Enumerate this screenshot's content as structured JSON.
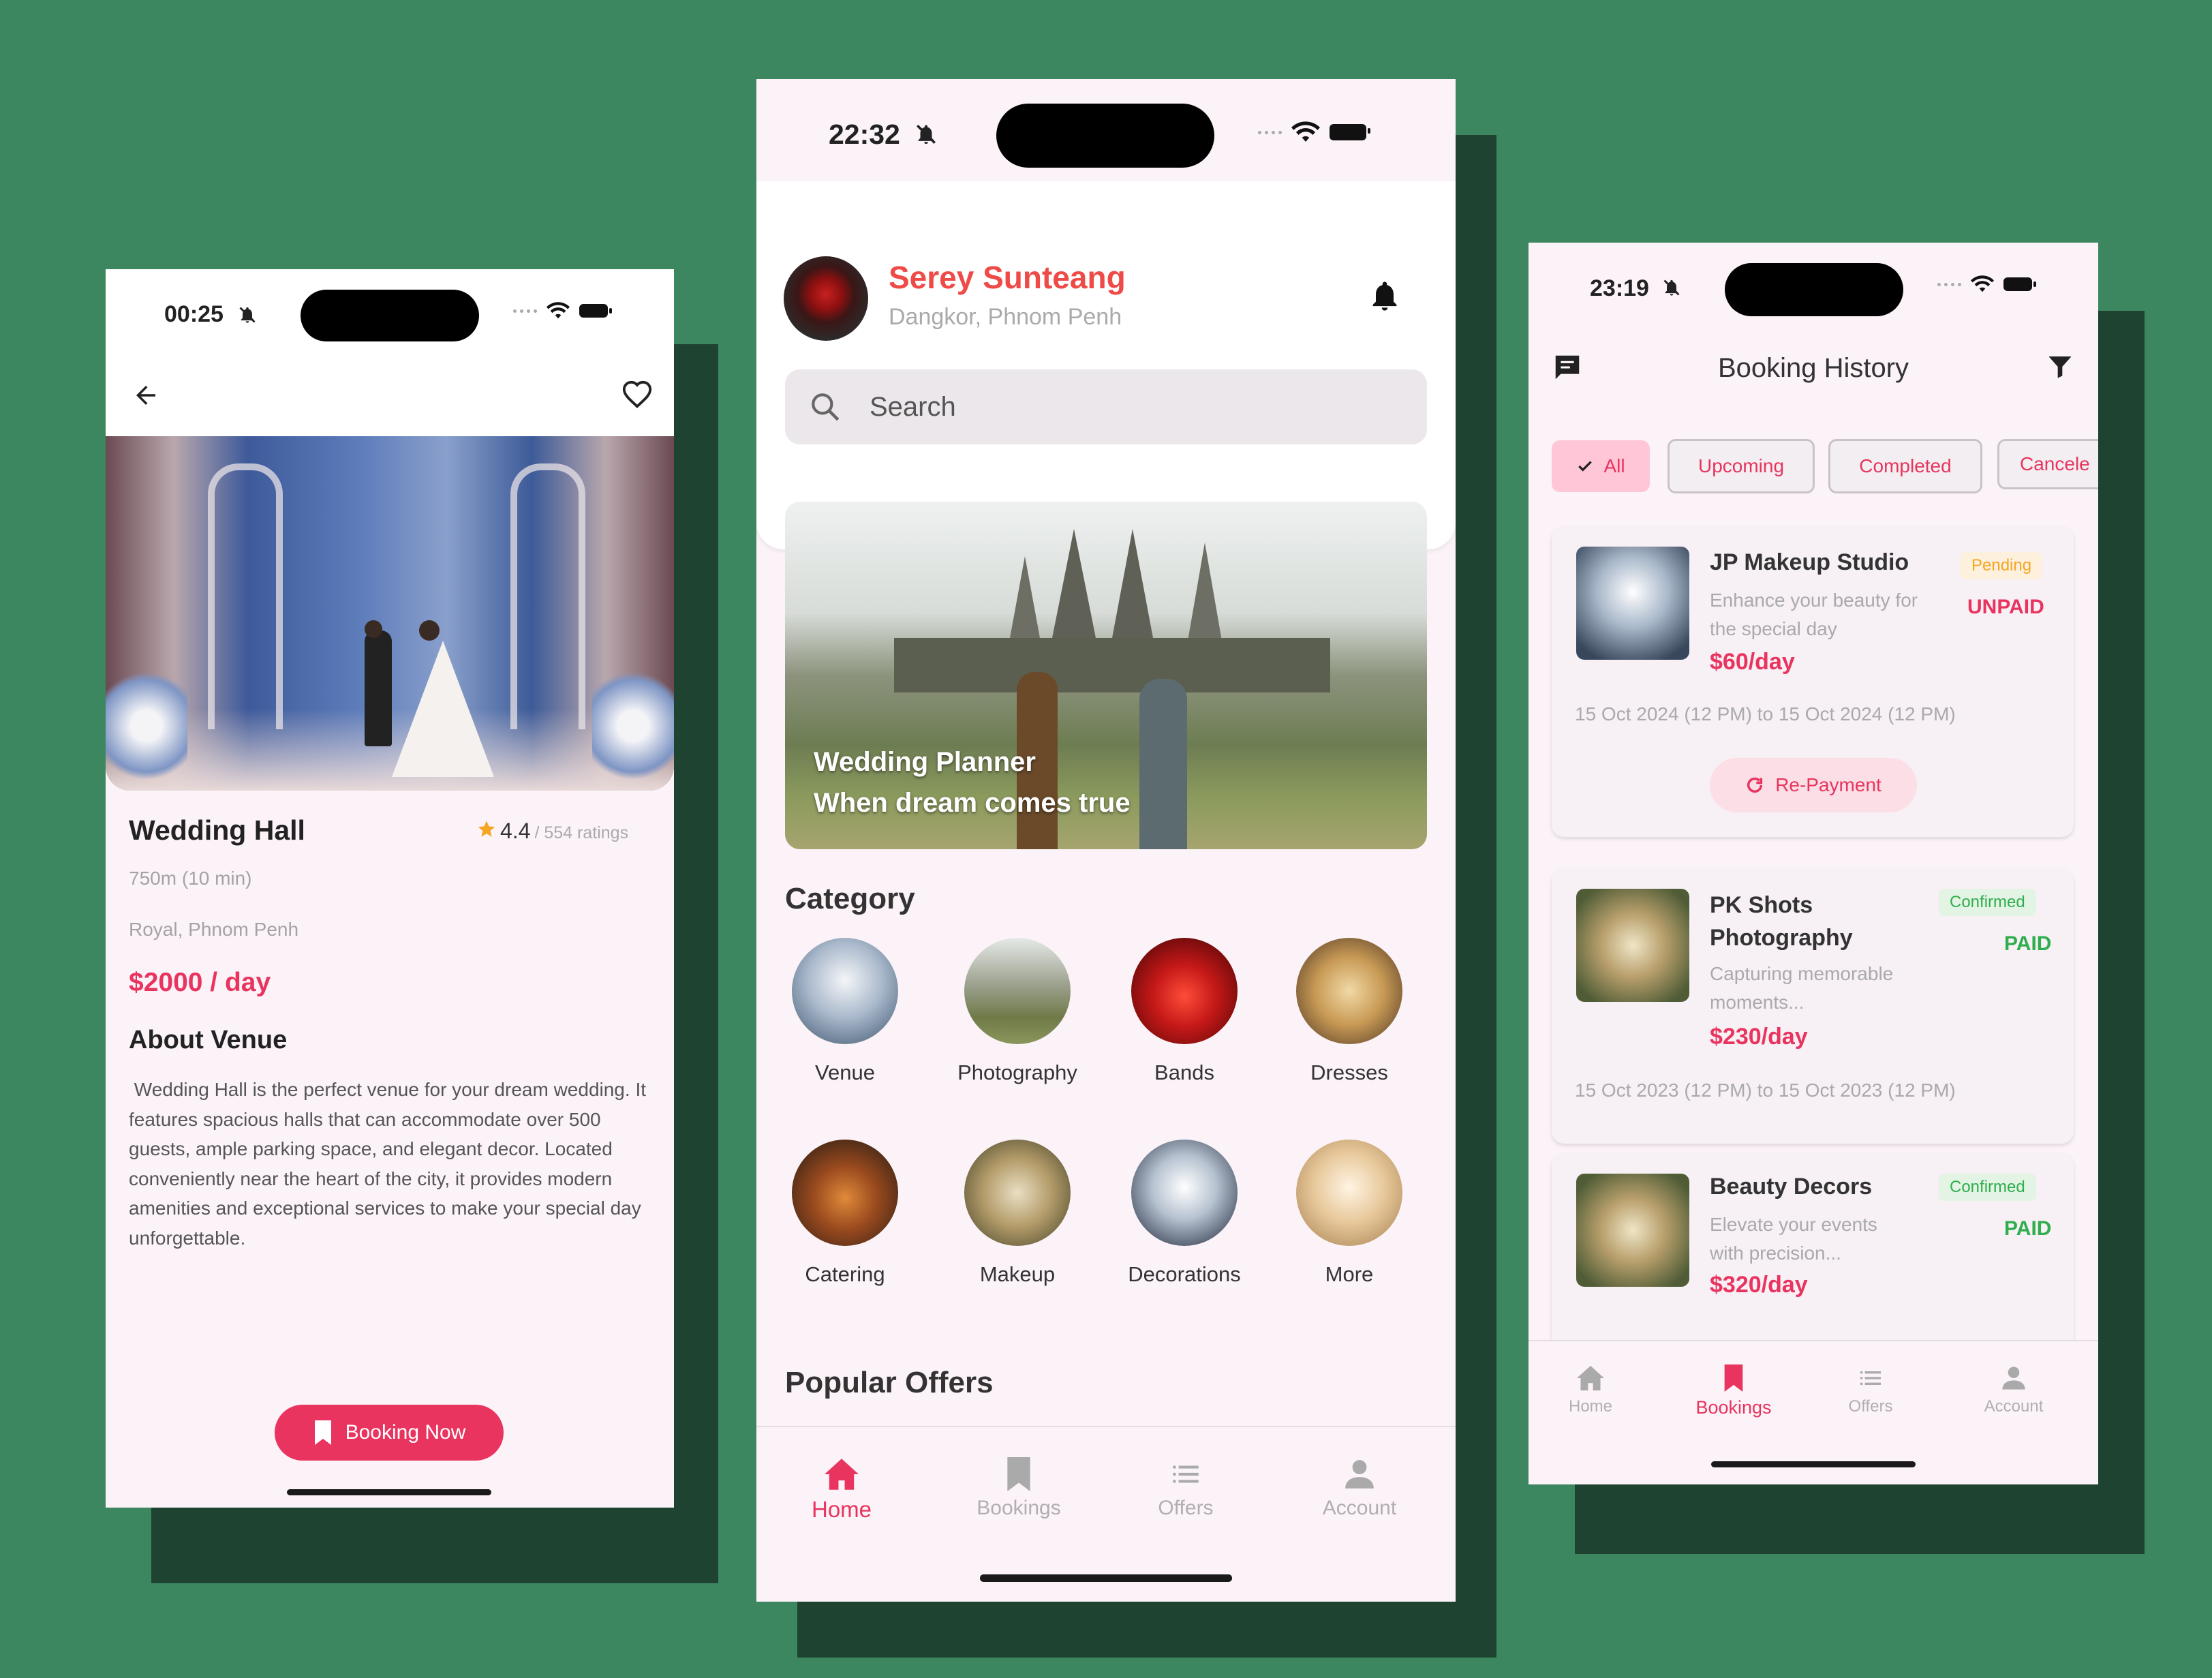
{
  "left": {
    "status_time": "00:25",
    "hero_image": "wedding-hall-stage-photo",
    "title": "Wedding Hall",
    "rating": "4.4",
    "rating_count": "/ 554 ratings",
    "distance": "750m (10 min)",
    "location": "Royal, Phnom Penh",
    "price": "$2000 / day",
    "about_heading": "About Venue",
    "about_text": " Wedding Hall is the perfect venue for your dream wedding. It features spacious halls that can accommodate over 500 guests, ample parking space, and elegant decor. Located conveniently near the heart of the city, it provides modern amenities and exceptional services to make your special day unforgettable.",
    "booking_button": "Booking Now"
  },
  "center": {
    "status_time": "22:32",
    "user_name": "Serey Sunteang",
    "user_location": "Dangkor, Phnom Penh",
    "search_placeholder": "Search",
    "banner_line1": "Wedding Planner",
    "banner_line2": "When dream comes true",
    "category_heading": "Category",
    "categories": [
      "Venue",
      "Photography",
      "Bands",
      "Dresses",
      "Catering",
      "Makeup",
      "Decorations",
      "More"
    ],
    "popular_heading": "Popular Offers",
    "nav": [
      "Home",
      "Bookings",
      "Offers",
      "Account"
    ]
  },
  "right": {
    "status_time": "23:19",
    "title": "Booking History",
    "filters": [
      "All",
      "Upcoming",
      "Completed",
      "Cancele"
    ],
    "bookings": [
      {
        "name": "JP Makeup Studio",
        "desc1": "Enhance your beauty for",
        "desc2": "the special day",
        "price": "$60/day",
        "status": "Pending",
        "payment": "UNPAID",
        "dates": "15 Oct 2024 (12 PM) to 15 Oct 2024 (12 PM)",
        "action": "Re-Payment"
      },
      {
        "name1": "PK Shots",
        "name2": "Photography",
        "desc1": "Capturing memorable",
        "desc2": "moments...",
        "price": "$230/day",
        "status": "Confirmed",
        "payment": "PAID",
        "dates": "15 Oct 2023 (12 PM) to 15 Oct 2023 (12 PM)"
      },
      {
        "name": "Beauty Decors",
        "desc1": "Elevate your events",
        "desc2": "with precision...",
        "price": "$320/day",
        "status": "Confirmed",
        "payment": "PAID"
      }
    ],
    "nav": [
      "Home",
      "Bookings",
      "Offers",
      "Account"
    ]
  },
  "colors": {
    "accent": "#e8345e",
    "background": "#3d8760",
    "shadow": "#1e4431",
    "paid": "#2fae4e",
    "pending": "#f5a623"
  }
}
